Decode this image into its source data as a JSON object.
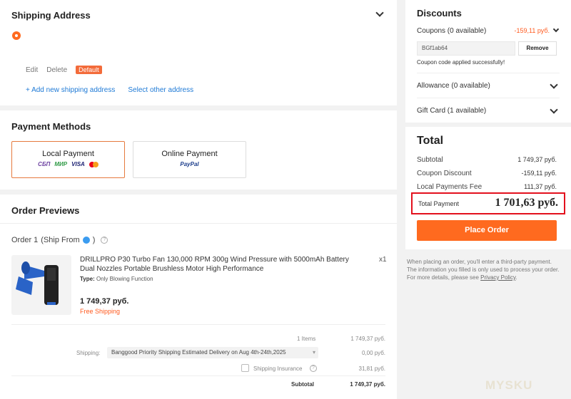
{
  "shipping": {
    "title": "Shipping Address",
    "edit": "Edit",
    "delete": "Delete",
    "default_badge": "Default",
    "add_address": "+ Add new shipping address",
    "select_other": "Select other address"
  },
  "payment": {
    "title": "Payment Methods",
    "local": {
      "label": "Local Payment",
      "logos": [
        "СБП",
        "МИР",
        "VISA",
        "mastercard"
      ]
    },
    "online": {
      "label": "Online Payment",
      "logos": [
        "PayPal"
      ]
    }
  },
  "order": {
    "title": "Order Previews",
    "order_label": "Order 1",
    "ship_from": "(Ship From",
    "ship_from_close": ")",
    "product_name": "DRILLPRO P30 Turbo Fan 130,000 RPM 300g Wind Pressure with 5000mAh Battery Dual Nozzles Portable Brushless Motor High Performance",
    "type_label": "Type:",
    "type_value": "Only Blowing Function",
    "qty": "x1",
    "price": "1 749,37 руб.",
    "free_shipping": "Free Shipping",
    "items_count": "1 Items",
    "items_total": "1 749,37 руб.",
    "shipping_label": "Shipping:",
    "shipping_method": "Banggood Priority Shipping Estimated Delivery on Aug 4th-24th,2025",
    "shipping_cost": "0,00 руб.",
    "insurance_label": "Shipping Insurance",
    "insurance_cost": "31,81 руб.",
    "subtotal_label": "Subtotal",
    "subtotal_value": "1 749,37 руб."
  },
  "discounts": {
    "title": "Discounts",
    "coupons_label": "Coupons (0 available)",
    "coupons_value": "-159,11 руб.",
    "coupon_code": "BGf1ab64",
    "remove": "Remove",
    "applied_msg": "Coupon code applied successfully!",
    "allowance": "Allowance (0 available)",
    "gift_card": "Gift Card (1 available)"
  },
  "total": {
    "title": "Total",
    "subtotal_label": "Subtotal",
    "subtotal_value": "1 749,37 руб.",
    "coupon_label": "Coupon Discount",
    "coupon_value": "-159,11 руб.",
    "fee_label": "Local Payments Fee",
    "fee_value": "111,37 руб.",
    "payment_label": "Total Payment",
    "payment_value": "1 701,63 руб.",
    "place_order": "Place Order"
  },
  "note": {
    "text": "When placing an order, you'll enter a third-party payment. The information you filled is only used to process your order. For more details, please see",
    "link": "Privacy Policy",
    "end": "."
  },
  "watermark": "MYSKU"
}
